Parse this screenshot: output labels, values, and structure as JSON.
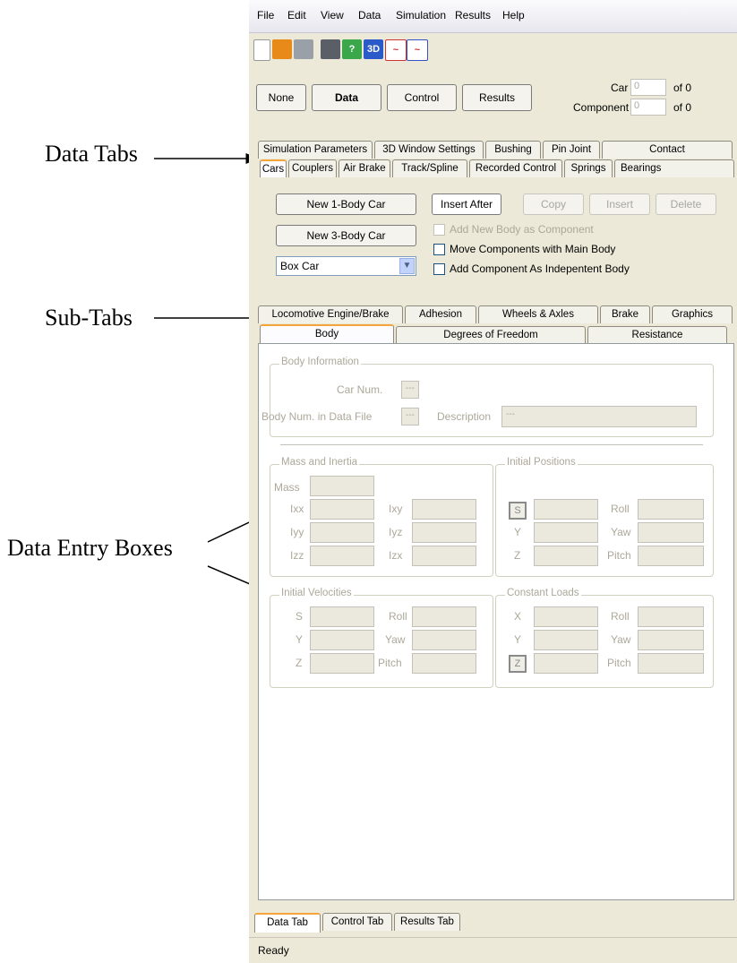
{
  "callouts": {
    "data_tabs": "Data Tabs",
    "sub_tabs": "Sub-Tabs",
    "data_entry_boxes": "Data Entry Boxes"
  },
  "menu": [
    "File",
    "Edit",
    "View",
    "Data",
    "Simulation",
    "Results",
    "Help"
  ],
  "toolbar": {
    "icon_3d": "3D"
  },
  "mode_buttons": {
    "none": "None",
    "data": "Data",
    "control": "Control",
    "results": "Results"
  },
  "selectors": {
    "car_label": "Car",
    "car_value": "0",
    "car_of": "of 0",
    "component_label": "Component",
    "component_value": "0",
    "component_of": "of 0"
  },
  "data_tabs_row1": [
    "Simulation Parameters",
    "3D Window Settings",
    "Bushing",
    "Pin Joint",
    "Contact"
  ],
  "data_tabs_row2": [
    "Cars",
    "Couplers",
    "Air Brake",
    "Track/Spline",
    "Recorded Control",
    "Springs",
    "Bearings"
  ],
  "car_buttons": {
    "new_1body": "New 1-Body Car",
    "new_3body": "New 3-Body Car",
    "car_type": "Box Car",
    "insert_after": "Insert After",
    "copy": "Copy",
    "insert": "Insert",
    "delete": "Delete"
  },
  "checkboxes": {
    "add_new_body": "Add New Body as Component",
    "move_components": "Move Components with Main Body",
    "add_component": "Add Component As Indepentent Body"
  },
  "sub_tabs_row1": [
    "Locomotive Engine/Brake",
    "Adhesion",
    "Wheels & Axles",
    "Brake",
    "Graphics"
  ],
  "sub_tabs_row2": [
    "Body",
    "Degrees of Freedom",
    "Resistance"
  ],
  "body_info": {
    "title": "Body Information",
    "car_num": "Car Num.",
    "body_num": "Body Num. in Data File",
    "description": "Description",
    "placeholder": "---"
  },
  "mass_inertia": {
    "title": "Mass and Inertia",
    "mass": "Mass",
    "ixx": "Ixx",
    "iyy": "Iyy",
    "izz": "Izz",
    "ixy": "Ixy",
    "iyz": "Iyz",
    "izx": "Izx"
  },
  "initial_positions": {
    "title": "Initial Positions",
    "s": "S",
    "y": "Y",
    "z": "Z",
    "roll": "Roll",
    "yaw": "Yaw",
    "pitch": "Pitch"
  },
  "initial_velocities": {
    "title": "Initial Velocities",
    "s": "S",
    "y": "Y",
    "z": "Z",
    "roll": "Roll",
    "yaw": "Yaw",
    "pitch": "Pitch"
  },
  "constant_loads": {
    "title": "Constant Loads",
    "x": "X",
    "y": "Y",
    "z": "Z",
    "roll": "Roll",
    "yaw": "Yaw",
    "pitch": "Pitch"
  },
  "bottom_tabs": [
    "Data Tab",
    "Control Tab",
    "Results Tab"
  ],
  "status": "Ready"
}
